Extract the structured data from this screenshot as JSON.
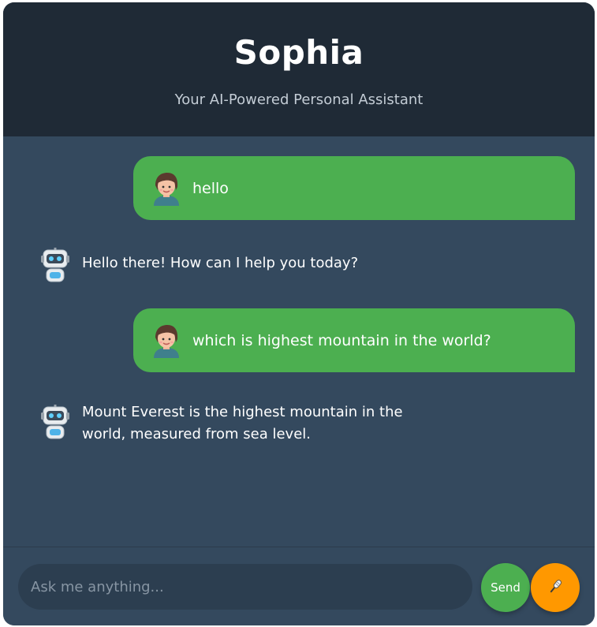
{
  "header": {
    "title": "Sophia",
    "subtitle": "Your AI-Powered Personal Assistant"
  },
  "messages": [
    {
      "role": "user",
      "text": "hello",
      "avatar": "user-avatar-icon"
    },
    {
      "role": "bot",
      "text": "Hello there! How can I help you today?",
      "avatar": "robot-avatar-icon"
    },
    {
      "role": "user",
      "text": "which is highest mountain in the world?",
      "avatar": "user-avatar-icon"
    },
    {
      "role": "bot",
      "text": "Mount Everest is the highest mountain in the world, measured from sea level.",
      "avatar": "robot-avatar-icon"
    }
  ],
  "composer": {
    "placeholder": "Ask me anything...",
    "value": "",
    "send_label": "Send",
    "mic_icon": "microphone-icon"
  },
  "colors": {
    "header_bg": "#1f2a36",
    "chat_bg": "#34495e",
    "user_bubble": "#4caf50",
    "send_button": "#4caf50",
    "mic_button": "#ff9800",
    "input_bg": "#2c3e50"
  }
}
